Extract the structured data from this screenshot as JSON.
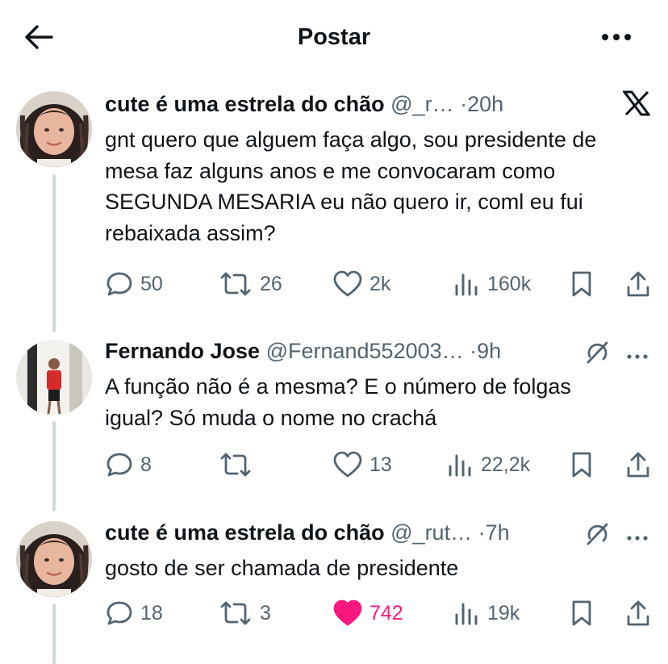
{
  "header": {
    "title": "Postar"
  },
  "tweets": [
    {
      "name": "cute é uma estrela do chão",
      "handle": "@_r…",
      "time": "20h",
      "text": "gnt quero que alguem faça algo, sou presidente de mesa faz alguns anos e me convocaram como SEGUNDA MESARIA eu não quero ir, coml eu fui rebaixada assim?",
      "replies": "50",
      "reposts": "26",
      "likes": "2k",
      "views": "160k",
      "liked": false,
      "corner_icon": "x-logo-icon"
    },
    {
      "name": "Fernando Jose",
      "handle": "@Fernand552003…",
      "time": "9h",
      "text": "A função não é a mesma? E o número de folgas igual? Só muda o nome no crachá",
      "replies": "8",
      "reposts": "",
      "likes": "13",
      "views": "22,2k",
      "liked": false,
      "corner_icon": "grok-icon"
    },
    {
      "name": "cute é uma estrela do chão",
      "handle": "@_rut…",
      "time": "7h",
      "text": "gosto de ser chamada de presidente",
      "replies": "18",
      "reposts": "3",
      "likes": "742",
      "views": "19k",
      "liked": true,
      "corner_icon": "grok-icon"
    }
  ],
  "colors": {
    "like_active": "#f91880",
    "muted": "#536471",
    "thread_line": "#cfd9de"
  }
}
